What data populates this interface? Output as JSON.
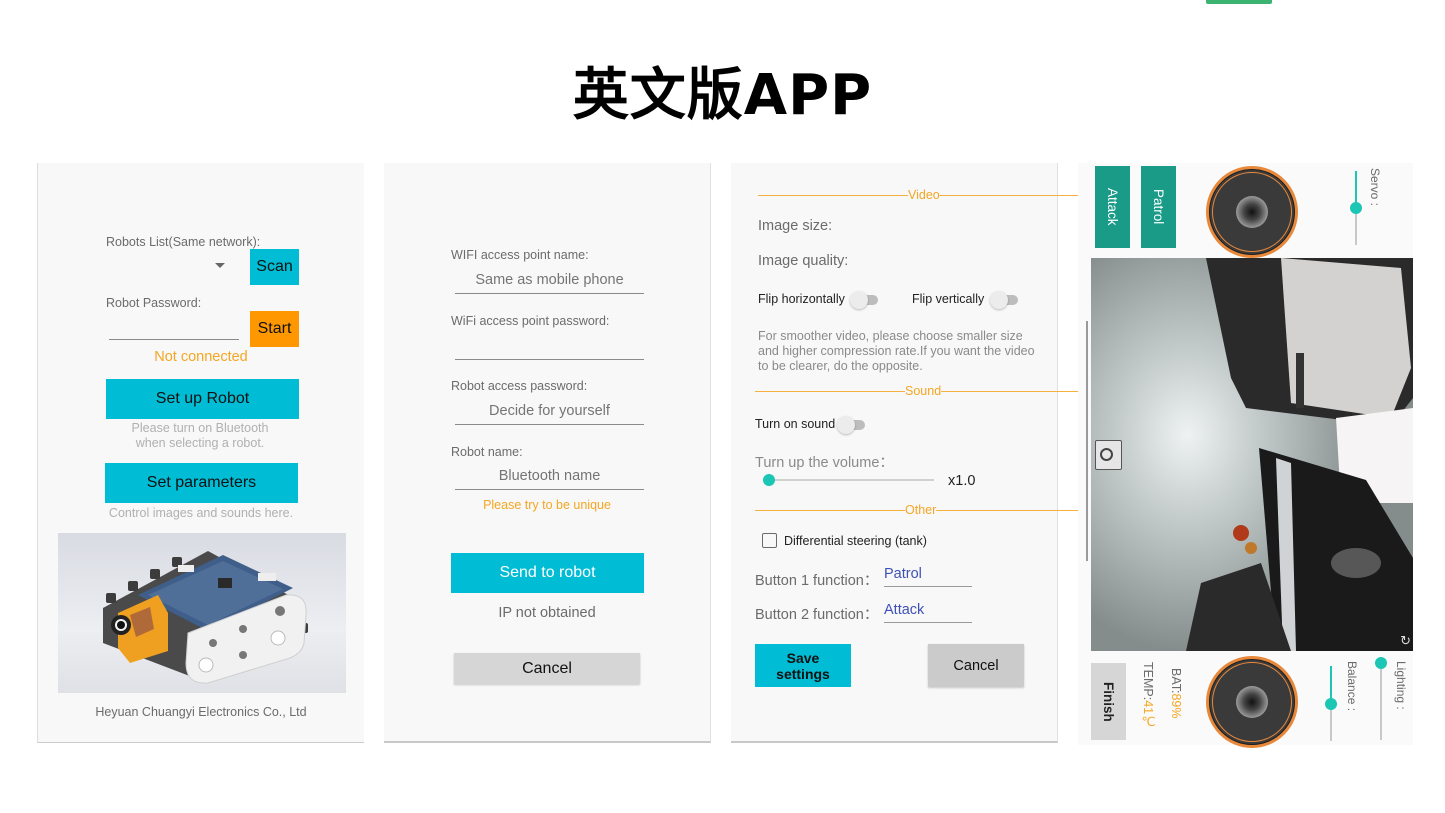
{
  "page": {
    "title": "英文版APP"
  },
  "colors": {
    "accent_cyan": "#00bcd4",
    "accent_orange": "#ff9800",
    "section_orange": "#f5a623",
    "teal_button": "#1a9b87",
    "link_blue": "#3f51b5",
    "slider_teal": "#1cc6b5"
  },
  "screen_main": {
    "robots_list_label": "Robots List(Same network):",
    "robots_list_value": "",
    "dropdown_icon": "caret-down-icon",
    "scan_label": "Scan",
    "password_label": "Robot Password:",
    "password_value": "",
    "start_label": "Start",
    "status": "Not connected",
    "setup_robot_label": "Set up Robot",
    "setup_hint": "Please turn on Bluetooth when selecting a robot.",
    "set_parameters_label": "Set parameters",
    "parameters_hint": "Control images and sounds here.",
    "robot_image_alt": "tracked robot rendering",
    "company": "Heyuan Chuangyi Electronics Co., Ltd"
  },
  "screen_setup": {
    "wifi_name_label": "WIFI access point name:",
    "wifi_name_placeholder": "Same as mobile phone",
    "wifi_password_label": "WiFi access point password:",
    "wifi_password_value": "",
    "robot_password_label": "Robot access password:",
    "robot_password_placeholder": "Decide for yourself",
    "robot_name_label": "Robot name:",
    "robot_name_placeholder": "Bluetooth name",
    "robot_name_hint": "Please try to be unique",
    "send_label": "Send to robot",
    "ip_status": "IP not obtained",
    "cancel_label": "Cancel"
  },
  "screen_settings": {
    "video_section": "————————————Video————————————",
    "image_size_label": "Image size:",
    "image_quality_label": "Image quality:",
    "flip_h_label": "Flip horizontally",
    "flip_h_on": false,
    "flip_v_label": "Flip vertically",
    "flip_v_on": false,
    "video_hint": "For smoother video, please choose smaller size and higher compression rate.If you want the video to be clearer, do the opposite.",
    "sound_section": "————————————Sound————————————",
    "sound_label": "Turn on sound",
    "sound_on": false,
    "volume_label": "Turn up the volume：",
    "volume_value": "x1.0",
    "volume_fraction": 0.0,
    "other_section": "————————————Other————————————",
    "diff_steering_label": "Differential steering (tank)",
    "diff_steering_checked": false,
    "button1_label": "Button 1 function：",
    "button1_value": "Patrol",
    "button2_label": "Button 2 function：",
    "button2_value": "Attack",
    "save_label": "Save settings",
    "cancel_label": "Cancel"
  },
  "screen_control": {
    "attack_label": "Attack",
    "patrol_label": "Patrol",
    "servo_label": "Servo :",
    "servo_fraction": 0.5,
    "camera_icon": "camera-icon",
    "rotate_icon": "rotate-icon",
    "finish_label": "Finish",
    "temp_label": "TEMP:",
    "temp_value": "41℃",
    "bat_label": "BAT:",
    "bat_value": "89%",
    "balance_label": "Balance :",
    "balance_fraction": 0.5,
    "lighting_label": "Lighting :",
    "lighting_fraction": 0.0
  }
}
